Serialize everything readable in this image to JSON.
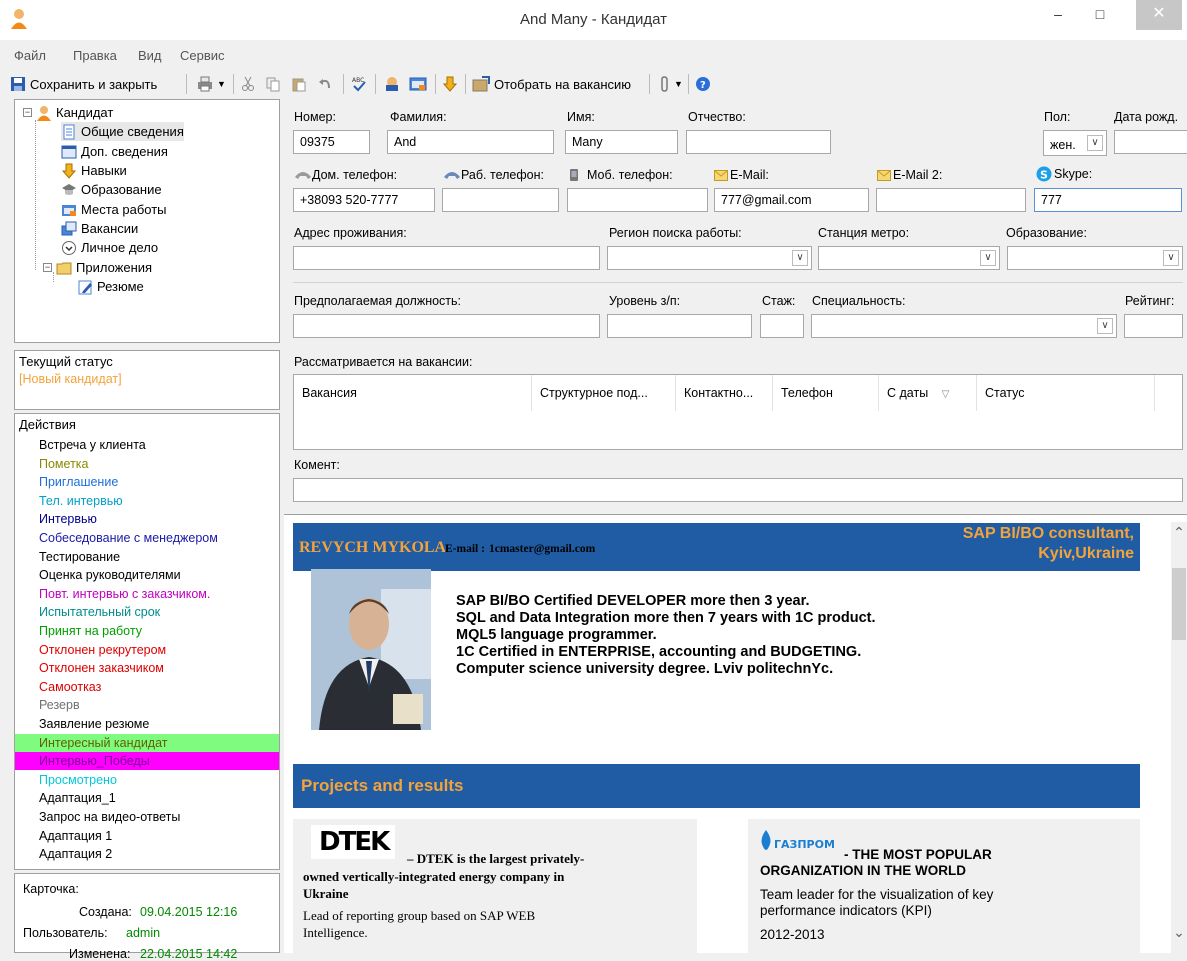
{
  "window": {
    "title": "And Many - Кандидат",
    "minimize": "–",
    "maximize": "□",
    "close": "✕"
  },
  "menu": [
    "Файл",
    "Правка",
    "Вид",
    "Сервис"
  ],
  "toolbar": {
    "save_close": "Сохранить и закрыть",
    "assign_vacancy": "Отобрать на вакансию"
  },
  "tree": {
    "root": "Кандидат",
    "items": [
      "Общие сведения",
      "Доп. сведения",
      "Навыки",
      "Образование",
      "Места работы",
      "Вакансии",
      "Личное дело"
    ],
    "attachments": "Приложения",
    "resume": "Резюме"
  },
  "status": {
    "title": "Текущий статус",
    "value": "[Новый кандидат]",
    "color": "#f4a33a"
  },
  "actions": {
    "title": "Действия",
    "items": [
      {
        "label": "Встреча у клиента",
        "color": "#000000",
        "bg": ""
      },
      {
        "label": "Пометка",
        "color": "#8a8a00",
        "bg": ""
      },
      {
        "label": "Приглашение",
        "color": "#1e6fd9",
        "bg": ""
      },
      {
        "label": "Тел. интервью",
        "color": "#00a0c8",
        "bg": ""
      },
      {
        "label": "Интервью",
        "color": "#00008b",
        "bg": ""
      },
      {
        "label": "Собеседование с менеджером",
        "color": "#1a1aa6",
        "bg": ""
      },
      {
        "label": "Тестирование",
        "color": "#000000",
        "bg": ""
      },
      {
        "label": "Оценка руководителями",
        "color": "#000000",
        "bg": ""
      },
      {
        "label": "Повт. интервью с заказчиком.",
        "color": "#c000c0",
        "bg": ""
      },
      {
        "label": "Испытательный срок",
        "color": "#008b8b",
        "bg": ""
      },
      {
        "label": "Принят на работу",
        "color": "#00a000",
        "bg": ""
      },
      {
        "label": "Отклонен рекрутером",
        "color": "#e00000",
        "bg": ""
      },
      {
        "label": "Отклонен заказчиком",
        "color": "#e00000",
        "bg": ""
      },
      {
        "label": "Самоотказ",
        "color": "#e00000",
        "bg": ""
      },
      {
        "label": "Резерв",
        "color": "#707070",
        "bg": ""
      },
      {
        "label": "Заявление резюме",
        "color": "#000000",
        "bg": ""
      },
      {
        "label": "Интересный кандидат",
        "color": "#606000",
        "bg": "#7ffc7f"
      },
      {
        "label": "Интервью_Победы",
        "color": "#8000a0",
        "bg": "#ff00ff"
      },
      {
        "label": "Просмотрено",
        "color": "#00c8d8",
        "bg": ""
      },
      {
        "label": "Адаптация_1",
        "color": "#000000",
        "bg": ""
      },
      {
        "label": "Запрос на видео-ответы",
        "color": "#000000",
        "bg": ""
      },
      {
        "label": "Адаптация 1",
        "color": "#000000",
        "bg": ""
      },
      {
        "label": "Адаптация 2",
        "color": "#000000",
        "bg": ""
      },
      {
        "label": "•••",
        "color": "#000000",
        "bg": ""
      }
    ]
  },
  "card": {
    "title": "Карточка:",
    "created_label": "Создана:",
    "created_value": "09.04.2015 12:16",
    "user_label": "Пользователь:",
    "user_value": "admin",
    "changed_label": "Изменена:",
    "changed_value": "22.04.2015 14:42"
  },
  "form": {
    "number_label": "Номер:",
    "number": "09375",
    "surname_label": "Фамилия:",
    "surname": "And",
    "name_label": "Имя:",
    "name": "Many",
    "patronymic_label": "Отчество:",
    "patronymic": "",
    "sex_label": "Пол:",
    "sex": "жен.",
    "birth_label": "Дата рожд.",
    "home_phone_label": "Дом. телефон:",
    "home_phone": "+38093 520-7777",
    "work_phone_label": "Раб. телефон:",
    "work_phone": "",
    "mobile_label": "Моб. телефон:",
    "mobile": "",
    "email_label": "E-Mail:",
    "email": "777@gmail.com",
    "email2_label": "E-Mail 2:",
    "email2": "",
    "skype_label": "Skype:",
    "skype": "777",
    "address_label": "Адрес проживания:",
    "region_label": "Регион поиска работы:",
    "metro_label": "Станция метро:",
    "education_label": "Образование:",
    "position_label": "Предполагаемая должность:",
    "salary_label": "Уровень з/п:",
    "experience_label": "Стаж:",
    "specialty_label": "Специальность:",
    "rating_label": "Рейтинг:",
    "vacancies_label": "Рассматривается на вакансии:",
    "grid_columns": [
      "Вакансия",
      "Структурное под...",
      "Контактно...",
      "Телефон",
      "С даты",
      "Статус"
    ],
    "comment_label": "Комент:"
  },
  "resume": {
    "name": "REVYCH MYKOLA",
    "email_label": "E-mail :",
    "email": "1cmaster@gmail.com",
    "role_line1": "SAP BI/BO consultant,",
    "role_line2": "Kyiv,Ukraine",
    "summary": [
      "SAP BI/BO Certified DEVELOPER more then 3 year.",
      "SQL and Data Integration more then 7 years with 1C product.",
      "MQL5 language programmer.",
      "1C Certified in ENTERPRISE, accounting and BUDGETING.",
      "Computer science university degree. Lviv politechnYc."
    ],
    "projects_title": "Projects and results",
    "dtek_logo": "DTEK",
    "dtek_desc_1": "– DTEK is the largest privately-",
    "dtek_desc_2": "owned vertically-integrated energy company in",
    "dtek_desc_3": "Ukraine",
    "dtek_role_1": "Lead of reporting group based on SAP WEB",
    "dtek_role_2": "Intelligence.",
    "gazprom_logo": "ГАЗПРОМ",
    "gazprom_title_1": "- THE MOST POPULAR",
    "gazprom_title_2": "ORGANIZATION IN THE WORLD",
    "gazprom_role_1": "Team leader for the visualization of key",
    "gazprom_role_2": "performance indicators (KPI)",
    "gazprom_years": "2012-2013"
  }
}
